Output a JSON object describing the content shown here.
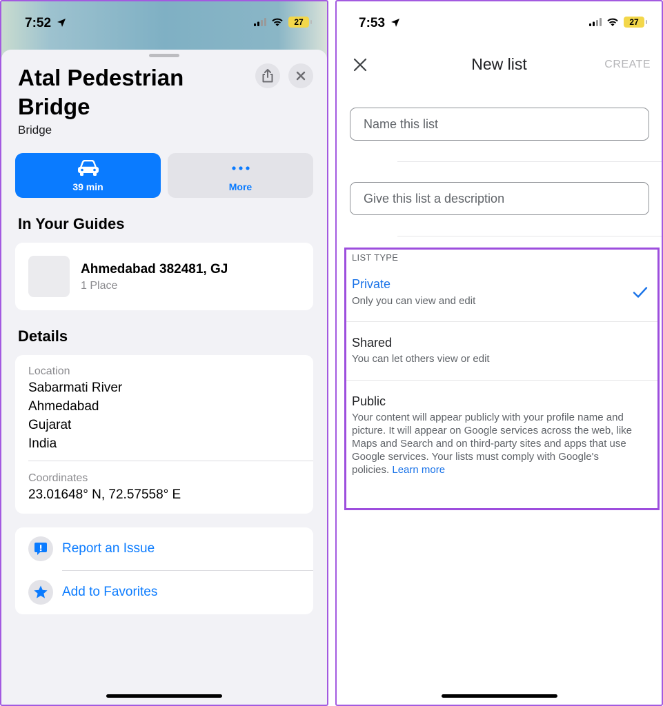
{
  "left_phone": {
    "status": {
      "time": "7:52",
      "battery": "27"
    },
    "place": {
      "title": "Atal Pedestrian Bridge",
      "subtitle": "Bridge"
    },
    "actions": {
      "drive_label": "39 min",
      "more_label": "More"
    },
    "guides": {
      "heading": "In Your Guides",
      "item": {
        "title": "Ahmedabad 382481, GJ",
        "subtitle": "1 Place"
      }
    },
    "details": {
      "heading": "Details",
      "location_label": "Location",
      "location_lines": [
        "Sabarmati River",
        "Ahmedabad",
        "Gujarat",
        "India"
      ],
      "coordinates_label": "Coordinates",
      "coordinates_value": "23.01648° N, 72.57558° E"
    },
    "links": {
      "report_label": "Report an Issue",
      "favorites_label": "Add to Favorites"
    }
  },
  "right_phone": {
    "status": {
      "time": "7:53",
      "battery": "27"
    },
    "nav": {
      "title": "New list",
      "create_label": "CREATE"
    },
    "name_field": {
      "placeholder": "Name this list"
    },
    "description_field": {
      "placeholder": "Give this list a description"
    },
    "list_type": {
      "heading": "LIST TYPE",
      "selected": "Private",
      "options": [
        {
          "title": "Private",
          "description": "Only you can view and edit"
        },
        {
          "title": "Shared",
          "description": "You can let others view or edit"
        },
        {
          "title": "Public",
          "description": "Your content will appear publicly with your profile name and picture. It will appear on Google services across the web, like Maps and Search and on third-party sites and apps that use Google services. Your lists must comply with Google's policies. ",
          "link": "Learn more"
        }
      ]
    }
  },
  "colors": {
    "ios_blue": "#0a7bff",
    "google_blue": "#1a73e8",
    "highlight_border": "#9d4edd",
    "battery_yellow": "#f3d74a"
  }
}
